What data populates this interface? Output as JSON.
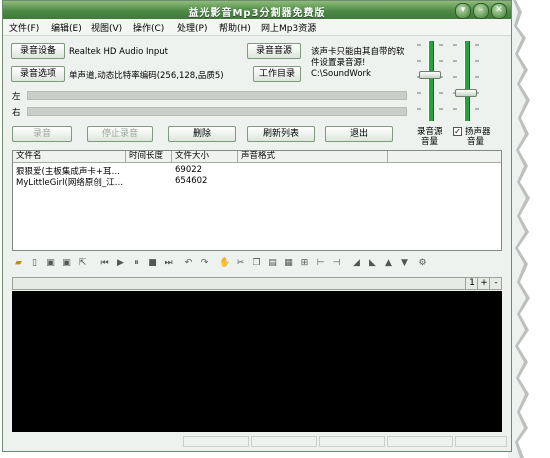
{
  "window": {
    "title": "益光影音Mp3分割器免费版",
    "title_buttons": [
      "▾",
      "–",
      "✕"
    ]
  },
  "menu": [
    "文件(F)",
    "编辑(E)",
    "视图(V)",
    "操作(C)",
    "处理(P)",
    "帮助(H)",
    "网上Mp3资源"
  ],
  "controls": {
    "record_device_button": "录音设备",
    "record_device_value": "Realtek HD Audio Input",
    "record_option_button": "录音选项",
    "record_option_value": "单声道,动态比特率编码(256,128,品质5)",
    "record_source_button": "录音音源",
    "record_source_note_line1": "该声卡只能由其自带的软",
    "record_source_note_line2": "件设置录音源!",
    "work_dir_button": "工作目录",
    "work_dir_value": "C:\\SoundWork"
  },
  "channels": {
    "left": "左",
    "right": "右"
  },
  "actions": {
    "record": "录音",
    "stop_record": "停止录音",
    "delete": "删除",
    "refresh": "刷新列表",
    "exit": "退出"
  },
  "volume": {
    "source_label_1": "录音源",
    "source_label_2": "音量",
    "speaker_label_1": "扬声器",
    "speaker_label_2": "音量",
    "speaker_checked": true,
    "source_level": 0.6,
    "speaker_level": 0.35
  },
  "file_list": {
    "columns": [
      "文件名",
      "时间长度",
      "文件大小",
      "声音格式"
    ],
    "rows": [
      {
        "name": "狠狠爱(主板集成声卡+耳…",
        "duration": "",
        "size": "69022",
        "format": ""
      },
      {
        "name": "MyLittleGirl(网络原创_江…",
        "duration": "",
        "size": "654602",
        "format": ""
      }
    ]
  },
  "toolbar_icons": [
    "open-icon",
    "new-icon",
    "save-icon",
    "save-as-icon",
    "export-icon",
    "skip-start-icon",
    "play-icon",
    "pause-icon",
    "stop-icon",
    "skip-end-icon",
    "undo-icon",
    "redo-icon",
    "hand-icon",
    "cut-icon",
    "copy-icon",
    "paste-icon",
    "select-all-icon",
    "trim-icon",
    "fade-in-icon",
    "fade-out-icon",
    "zoom-in-icon",
    "zoom-out-icon",
    "volume-up-icon",
    "volume-down-icon",
    "normalize-icon"
  ],
  "zoom": {
    "fit": "1",
    "plus": "+",
    "minus": "-"
  },
  "colors": {
    "title_green": "#4d8a45",
    "meter_green": "#27a33d",
    "canvas": "#000000"
  }
}
